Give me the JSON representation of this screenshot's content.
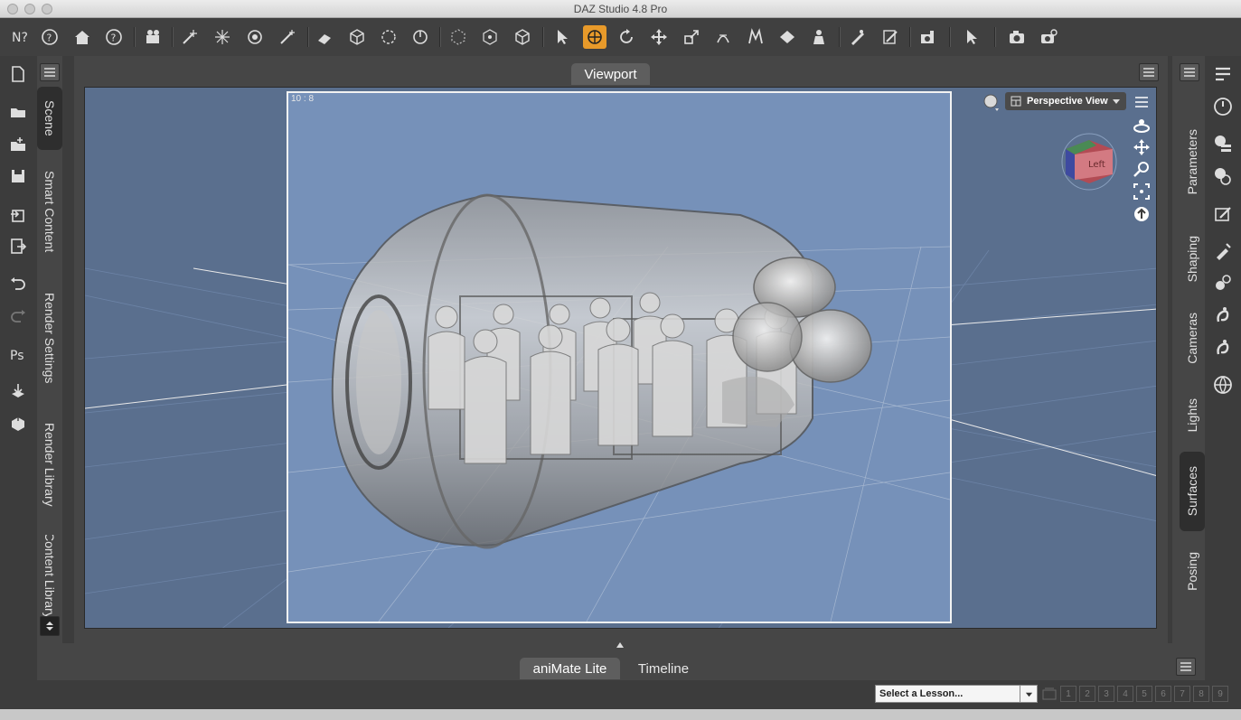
{
  "window": {
    "title": "DAZ Studio 4.8 Pro"
  },
  "colors": {
    "accent": "#e89a2a",
    "panel": "#464646",
    "viewport_bg": "#7691b9"
  },
  "toolbar": {
    "icons": [
      "whats-this-icon",
      "help-icon",
      "home-icon",
      "help-icon",
      "scene-group-icon",
      "spot-light-icon",
      "point-light-icon",
      "distant-light-icon",
      "linear-light-icon",
      "primitive-icon",
      "cube-icon",
      "node-select-icon",
      "sphere-icon",
      "null-icon",
      "joint-editor-icon",
      "geometry-editor-icon",
      "pointer-icon",
      "universal-tool-icon",
      "rotate-icon",
      "translate-icon",
      "scale-icon",
      "surface-selection-icon",
      "text-icon",
      "geometry-icon",
      "figure-icon",
      "weight-map-icon",
      "shaping-tool-icon",
      "camera-tool-icon",
      "node-pick-icon",
      "render-icon",
      "render-settings-icon"
    ],
    "active": "universal-tool-icon"
  },
  "left_tabs": [
    "Scene",
    "Smart Content",
    "Render Settings",
    "Render Library",
    "Content Library"
  ],
  "left_active": "Scene",
  "right_tabs": [
    "Parameters",
    "Shaping",
    "Cameras",
    "Lights",
    "Surfaces",
    "Posing"
  ],
  "right_active": "Surfaces",
  "viewport": {
    "tab_label": "Viewport",
    "aspect_label": "10 : 8",
    "view_name": "Perspective View",
    "cube_face": "Left"
  },
  "bottom_tabs": [
    "aniMate Lite",
    "Timeline"
  ],
  "bottom_active": "aniMate Lite",
  "lesson": {
    "placeholder": "Select a Lesson...",
    "steps": [
      "1",
      "2",
      "3",
      "4",
      "5",
      "6",
      "7",
      "8",
      "9"
    ]
  }
}
